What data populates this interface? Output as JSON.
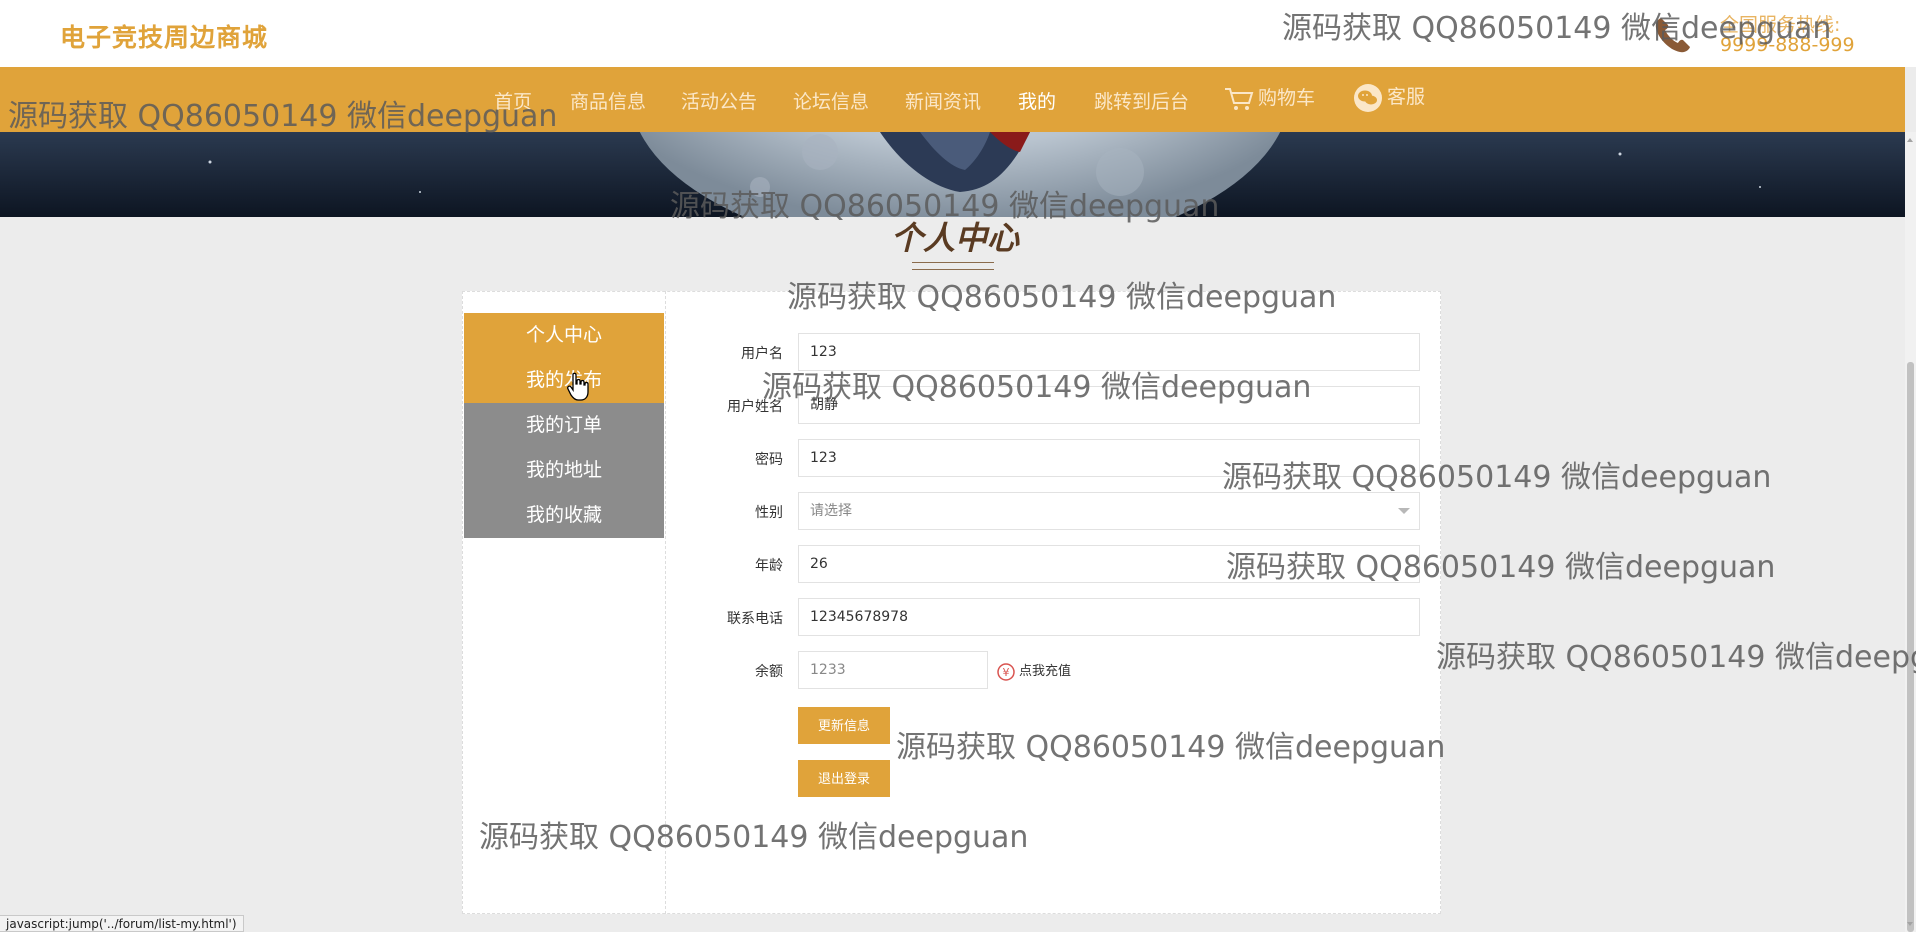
{
  "header": {
    "site_title": "电子竞技周边商城",
    "hotline_label": "全国服务热线:",
    "hotline_number": "9999-888-999"
  },
  "nav": {
    "items": [
      {
        "label": "首页"
      },
      {
        "label": "商品信息"
      },
      {
        "label": "活动公告"
      },
      {
        "label": "论坛信息"
      },
      {
        "label": "新闻资讯"
      },
      {
        "label": "我的"
      },
      {
        "label": "跳转到后台"
      },
      {
        "label": "购物车",
        "icon": "cart-icon"
      },
      {
        "label": "客服",
        "icon": "wechat-icon"
      }
    ],
    "active": "我的"
  },
  "page": {
    "heading": "个人中心"
  },
  "side_menu": {
    "items": [
      {
        "label": "个人中心"
      },
      {
        "label": "我的发布"
      },
      {
        "label": "我的订单"
      },
      {
        "label": "我的地址"
      },
      {
        "label": "我的收藏"
      }
    ]
  },
  "form": {
    "username_label": "用户名",
    "username_value": "123",
    "realname_label": "用户姓名",
    "realname_value": "胡静",
    "password_label": "密码",
    "password_value": "123",
    "gender_label": "性别",
    "gender_placeholder": "请选择",
    "age_label": "年龄",
    "age_value": "26",
    "phone_label": "联系电话",
    "phone_value": "12345678978",
    "balance_label": "余额",
    "balance_value": "1233",
    "recharge_label": "点我充值",
    "update_button": "更新信息",
    "logout_button": "退出登录"
  },
  "status_bar": {
    "link_preview": "javascript:jump('../forum/list-my.html')"
  },
  "watermark": {
    "text": "源码获取 QQ86050149 微信deepguan"
  },
  "colors": {
    "accent": "#e0a33a",
    "menu_inactive": "#8c8c8c",
    "page_bg": "#ececec"
  }
}
